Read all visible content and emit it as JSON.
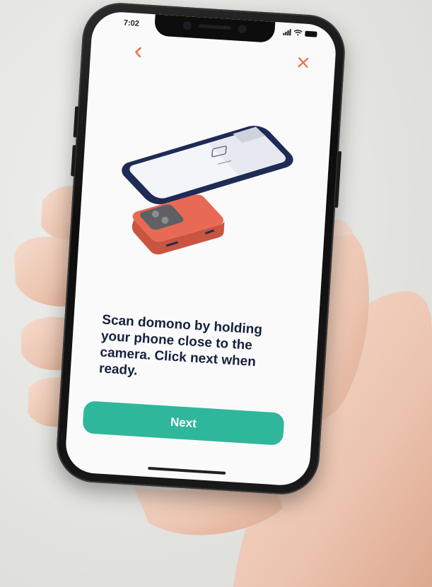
{
  "status_bar": {
    "time": "7:02"
  },
  "header": {
    "back_icon": "chevron-left-icon",
    "close_icon": "close-icon"
  },
  "onboarding": {
    "instruction": "Scan domono by holding your phone close to the camera. Click next when ready.",
    "next_label": "Next"
  },
  "colors": {
    "accent": "#2fb79b",
    "header_icon": "#f0694a",
    "text_dark": "#16213d",
    "device_coral": "#e86a55",
    "phone_outline": "#1d2b55"
  }
}
